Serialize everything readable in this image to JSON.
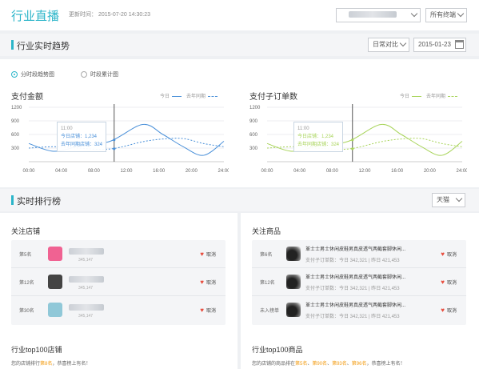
{
  "header": {
    "title": "行业直播",
    "update_label": "更新时间：",
    "update_time": "2015-07-20  14:30:23",
    "terminal_select": "所有终端"
  },
  "trend": {
    "title": "行业实时趋势",
    "compare_select": "日常对比",
    "date_value": "2015-01-23",
    "radio_options": [
      {
        "label": "分时段趋势图",
        "selected": true
      },
      {
        "label": "时段累计图",
        "selected": false
      }
    ]
  },
  "charts": [
    {
      "title": "支付金额",
      "legend_today": "今日",
      "legend_lastyear": "去年同期",
      "color": "#4a90d9",
      "tooltip": {
        "time": "11:00",
        "today": "今日店铺：1,234",
        "lastyear": "去年同期店铺：324"
      }
    },
    {
      "title": "支付子订单数",
      "legend_today": "今日",
      "legend_lastyear": "去年同期",
      "color": "#a8d45a",
      "tooltip": {
        "time": "11:00",
        "today": "今日店铺：1,234",
        "lastyear": "去年同期店铺：324"
      }
    }
  ],
  "chart_data": [
    {
      "type": "line",
      "title": "支付金额",
      "x": [
        "00:00",
        "04:00",
        "08:00",
        "12:00",
        "16:00",
        "20:00",
        "24:00"
      ],
      "y_ticks": [
        1200,
        900,
        600,
        300
      ],
      "ylim": [
        0,
        1200
      ],
      "series": [
        {
          "name": "今日",
          "values": [
            400,
            230,
            330,
            450,
            820,
            600,
            330,
            140,
            450
          ]
        },
        {
          "name": "去年同期",
          "values": [
            300,
            330,
            300,
            280,
            440,
            500,
            510,
            400,
            330
          ]
        }
      ],
      "x_points": [
        0,
        3,
        6,
        10,
        14,
        16.5,
        19,
        21.5,
        24
      ]
    },
    {
      "type": "line",
      "title": "支付子订单数",
      "x": [
        "00:00",
        "04:00",
        "08:00",
        "12:00",
        "16:00",
        "20:00",
        "24:00"
      ],
      "y_ticks": [
        1200,
        900,
        600,
        300
      ],
      "ylim": [
        0,
        1200
      ],
      "series": [
        {
          "name": "今日",
          "values": [
            400,
            230,
            330,
            450,
            820,
            600,
            330,
            140,
            450
          ]
        },
        {
          "name": "去年同期",
          "values": [
            300,
            330,
            300,
            280,
            440,
            500,
            510,
            400,
            330
          ]
        }
      ],
      "x_points": [
        0,
        3,
        6,
        10,
        14,
        16.5,
        19,
        21.5,
        24
      ]
    }
  ],
  "ranking": {
    "title": "实时排行榜",
    "platform_select": "天猫",
    "shops_title": "关注店铺",
    "shops": [
      {
        "rank": "第5名",
        "num": "345,147",
        "cancel": "取消",
        "thumb_color": "#f06292"
      },
      {
        "rank": "第12名",
        "num": "345,147",
        "cancel": "取消",
        "thumb_color": "#444444"
      },
      {
        "rank": "第30名",
        "num": "345,147",
        "cancel": "取消",
        "thumb_color": "#90c8d8"
      }
    ],
    "goods_title": "关注商品",
    "goods": [
      {
        "rank": "第6名",
        "name": "革士士男士休闲皮鞋男真皮透气两截套脚休闲...",
        "stats": "支付子订单数：今日 342,321 | 昨日 421,453",
        "cancel": "取消"
      },
      {
        "rank": "第12名",
        "name": "革士士男士休闲皮鞋男真皮透气两截套脚休闲...",
        "stats": "支付子订单数：今日 342,321 | 昨日 421,453",
        "cancel": "取消"
      },
      {
        "rank": "未入榜单",
        "name": "革士士男士休闲皮鞋男真皮透气两截套脚休闲...",
        "stats": "支付子订单数：今日 342,321 | 昨日 421,453",
        "cancel": "取消"
      }
    ],
    "top_shops_title": "行业top100店铺",
    "top_shops_text_a": "您的店铺排行",
    "top_shops_rank": "第8名",
    "top_shops_text_b": "，恭喜榜上有名！",
    "top_goods_title": "行业top100商品",
    "top_goods_text_a": "您的店铺的商品排在",
    "top_goods_ranks": [
      "第5名",
      "第90名",
      "第93名",
      "第96名"
    ],
    "top_goods_text_b": "，恭喜榜上有名！"
  }
}
